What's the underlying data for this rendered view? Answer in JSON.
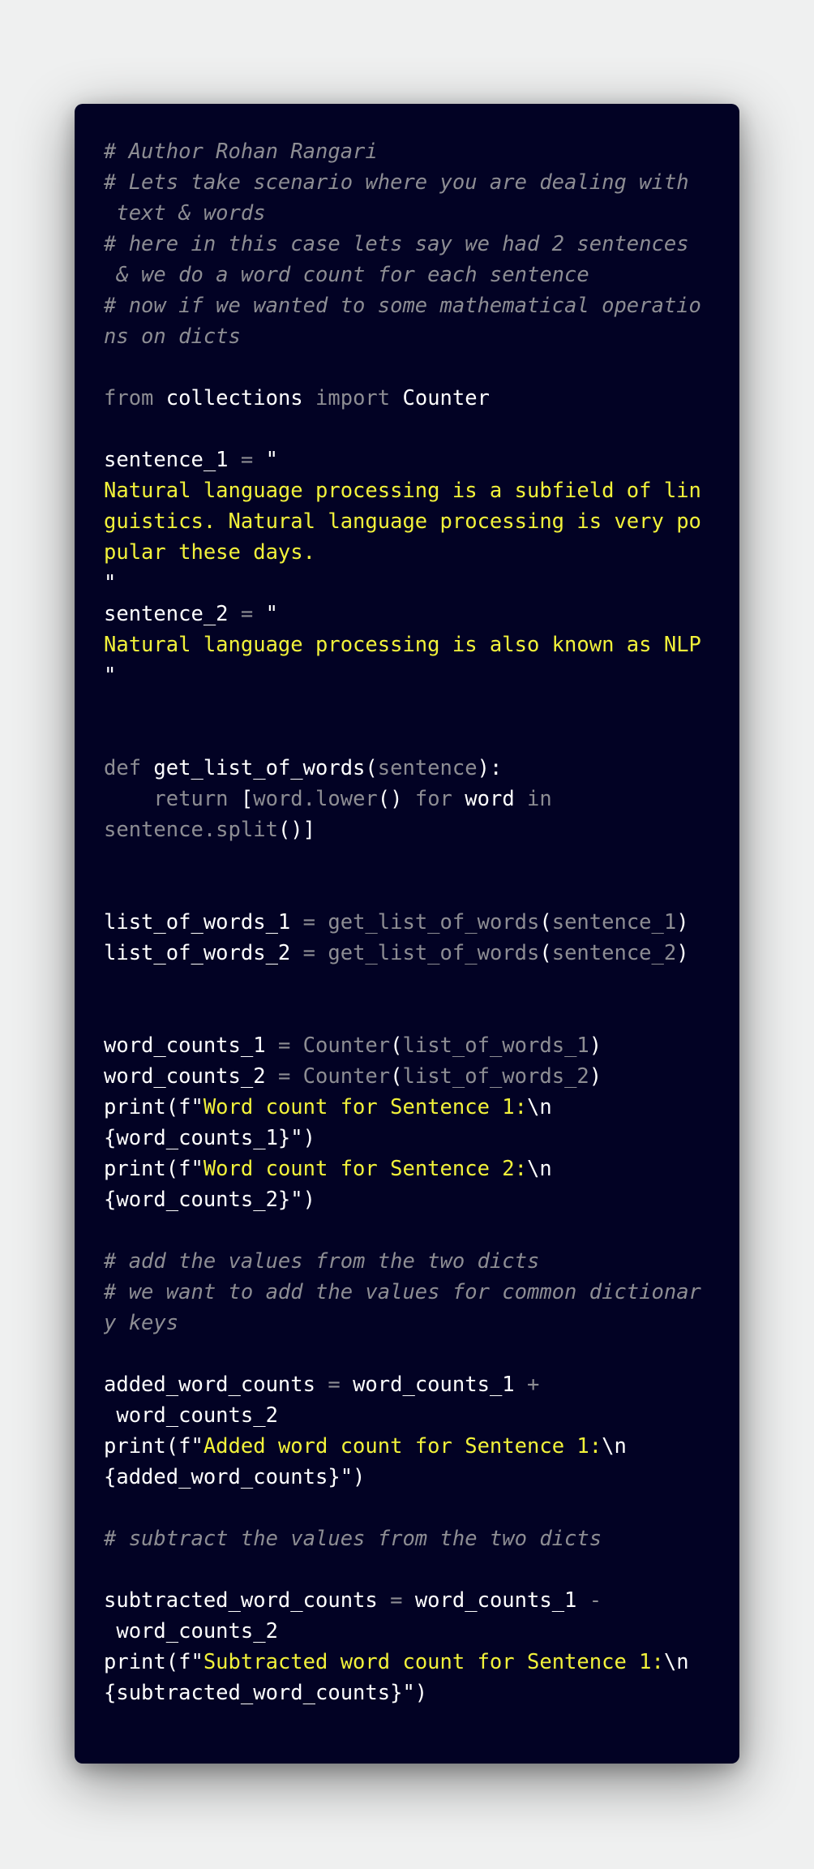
{
  "lines": [
    [
      {
        "t": "# Author Rohan Rangari",
        "k": "comment"
      }
    ],
    [
      {
        "t": "# Lets take scenario where you are dealing with",
        "k": "comment"
      }
    ],
    [
      {
        "t": " text & words",
        "k": "comment"
      }
    ],
    [
      {
        "t": "# here in this case lets say we had 2 sentences",
        "k": "comment"
      }
    ],
    [
      {
        "t": " & we do a word count for each sentence",
        "k": "comment"
      }
    ],
    [
      {
        "t": "# now if we wanted to some mathematical operatio",
        "k": "comment"
      }
    ],
    [
      {
        "t": "ns on dicts",
        "k": "comment"
      }
    ],
    [],
    [
      {
        "t": "from",
        "k": "kw"
      },
      {
        "t": " collections ",
        "k": "id"
      },
      {
        "t": "import",
        "k": "kw"
      },
      {
        "t": " Counter",
        "k": "id"
      }
    ],
    [],
    [
      {
        "t": "sentence_1",
        "k": "id"
      },
      {
        "t": " = ",
        "k": "op"
      },
      {
        "t": "\"",
        "k": "id"
      }
    ],
    [
      {
        "t": "Natural language processing is a subfield of lin",
        "k": "str"
      }
    ],
    [
      {
        "t": "guistics. Natural language processing is very po",
        "k": "str"
      }
    ],
    [
      {
        "t": "pular these days.",
        "k": "str"
      }
    ],
    [
      {
        "t": "\"",
        "k": "id"
      }
    ],
    [
      {
        "t": "sentence_2",
        "k": "id"
      },
      {
        "t": " = ",
        "k": "op"
      },
      {
        "t": "\"",
        "k": "id"
      }
    ],
    [
      {
        "t": "Natural language processing is also known as NLP",
        "k": "str"
      }
    ],
    [
      {
        "t": "\"",
        "k": "id"
      }
    ],
    [],
    [],
    [
      {
        "t": "def",
        "k": "kw"
      },
      {
        "t": " get_list_of_words",
        "k": "fn"
      },
      {
        "t": "(",
        "k": "paren"
      },
      {
        "t": "sentence",
        "k": "dim"
      },
      {
        "t": "):",
        "k": "paren"
      }
    ],
    [
      {
        "t": "    return ",
        "k": "kw"
      },
      {
        "t": "[",
        "k": "paren"
      },
      {
        "t": "word.lower",
        "k": "dim"
      },
      {
        "t": "()",
        "k": "paren"
      },
      {
        "t": " for ",
        "k": "kw"
      },
      {
        "t": "word",
        "k": "id"
      },
      {
        "t": " in",
        "k": "kw"
      }
    ],
    [
      {
        "t": "sentence.split",
        "k": "dim"
      },
      {
        "t": "()]",
        "k": "paren"
      }
    ],
    [],
    [],
    [
      {
        "t": "list_of_words_1",
        "k": "id"
      },
      {
        "t": " = ",
        "k": "op"
      },
      {
        "t": "get_list_of_words",
        "k": "dim"
      },
      {
        "t": "(",
        "k": "paren"
      },
      {
        "t": "sentence_1",
        "k": "dim"
      },
      {
        "t": ")",
        "k": "paren"
      }
    ],
    [
      {
        "t": "list_of_words_2",
        "k": "id"
      },
      {
        "t": " = ",
        "k": "op"
      },
      {
        "t": "get_list_of_words",
        "k": "dim"
      },
      {
        "t": "(",
        "k": "paren"
      },
      {
        "t": "sentence_2",
        "k": "dim"
      },
      {
        "t": ")",
        "k": "paren"
      }
    ],
    [],
    [],
    [
      {
        "t": "word_counts_1",
        "k": "id"
      },
      {
        "t": " = ",
        "k": "op"
      },
      {
        "t": "Counter",
        "k": "dim"
      },
      {
        "t": "(",
        "k": "paren"
      },
      {
        "t": "list_of_words_1",
        "k": "dim"
      },
      {
        "t": ")",
        "k": "paren"
      }
    ],
    [
      {
        "t": "word_counts_2",
        "k": "id"
      },
      {
        "t": " = ",
        "k": "op"
      },
      {
        "t": "Counter",
        "k": "dim"
      },
      {
        "t": "(",
        "k": "paren"
      },
      {
        "t": "list_of_words_2",
        "k": "dim"
      },
      {
        "t": ")",
        "k": "paren"
      }
    ],
    [
      {
        "t": "print(f\"",
        "k": "id"
      },
      {
        "t": "Word count for Sentence 1:",
        "k": "str"
      },
      {
        "t": "\\n",
        "k": "id"
      }
    ],
    [
      {
        "t": "{word_counts_1}\")",
        "k": "id"
      }
    ],
    [
      {
        "t": "print(f\"",
        "k": "id"
      },
      {
        "t": "Word count for Sentence 2:",
        "k": "str"
      },
      {
        "t": "\\n",
        "k": "id"
      }
    ],
    [
      {
        "t": "{word_counts_2}\")",
        "k": "id"
      }
    ],
    [],
    [
      {
        "t": "# add the values from the two dicts",
        "k": "comment"
      }
    ],
    [
      {
        "t": "# we want to add the values for common dictionar",
        "k": "comment"
      }
    ],
    [
      {
        "t": "y keys",
        "k": "comment"
      }
    ],
    [],
    [
      {
        "t": "added_word_counts",
        "k": "id"
      },
      {
        "t": " = ",
        "k": "op"
      },
      {
        "t": "word_counts_1",
        "k": "id"
      },
      {
        "t": " +",
        "k": "op"
      }
    ],
    [
      {
        "t": " word_counts_2",
        "k": "id"
      }
    ],
    [
      {
        "t": "print(f\"",
        "k": "id"
      },
      {
        "t": "Added word count for Sentence 1:",
        "k": "str"
      },
      {
        "t": "\\n",
        "k": "id"
      }
    ],
    [
      {
        "t": "{added_word_counts}\")",
        "k": "id"
      }
    ],
    [],
    [
      {
        "t": "# subtract the values from the two dicts",
        "k": "comment"
      }
    ],
    [],
    [
      {
        "t": "subtracted_word_counts",
        "k": "id"
      },
      {
        "t": " = ",
        "k": "op"
      },
      {
        "t": "word_counts_1",
        "k": "id"
      },
      {
        "t": " -",
        "k": "op"
      }
    ],
    [
      {
        "t": " word_counts_2",
        "k": "id"
      }
    ],
    [
      {
        "t": "print(f\"",
        "k": "id"
      },
      {
        "t": "Subtracted word count for Sentence 1:",
        "k": "str"
      },
      {
        "t": "\\n",
        "k": "id"
      }
    ],
    [
      {
        "t": "{subtracted_word_counts}\")",
        "k": "id"
      }
    ]
  ],
  "colors": {
    "background": "#eff0f0",
    "card": "#020224",
    "comment": "#8d8d93",
    "keyword": "#8d8d93",
    "string": "#f2f23a",
    "identifier": "#ffffff"
  }
}
